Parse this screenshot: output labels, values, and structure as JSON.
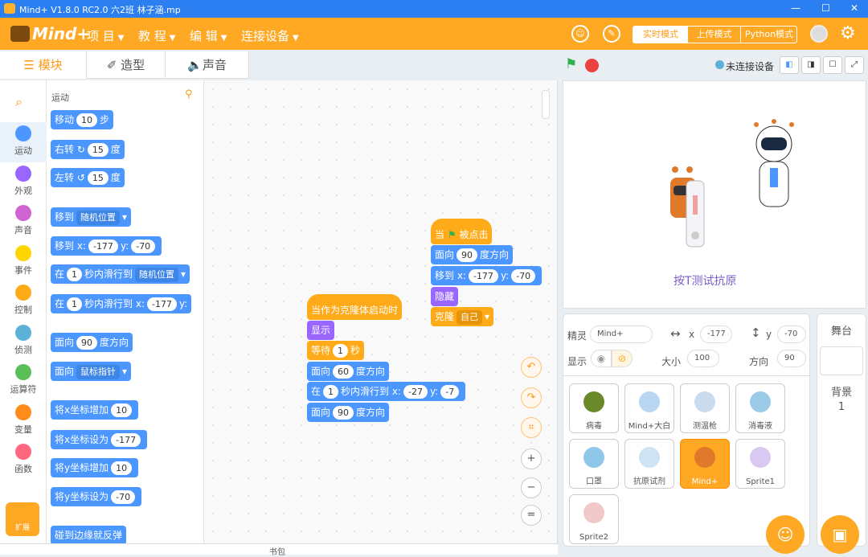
{
  "window": {
    "title": "Mind+ V1.8.0 RC2.0   六2班 林子涵.mp",
    "min": "—",
    "max": "☐",
    "close": "✕"
  },
  "menu": {
    "brand": "Mind+",
    "project": "项 目",
    "tutorial": "教 程",
    "edit": "编 辑",
    "connect": "连接设备"
  },
  "modes": {
    "realtime": "实时模式",
    "upload": "上传模式",
    "python": "Python模式"
  },
  "tabs": {
    "blocks": "模块",
    "costumes": "造型",
    "sounds": "声音"
  },
  "categories": [
    {
      "label": "运动",
      "color": "#4c97ff"
    },
    {
      "label": "外观",
      "color": "#9966ff"
    },
    {
      "label": "声音",
      "color": "#cf63cf"
    },
    {
      "label": "事件",
      "color": "#ffd500"
    },
    {
      "label": "控制",
      "color": "#ffab19"
    },
    {
      "label": "侦测",
      "color": "#5cb1d6"
    },
    {
      "label": "运算符",
      "color": "#59c059"
    },
    {
      "label": "变量",
      "color": "#ff8c1a"
    },
    {
      "label": "函数",
      "color": "#ff6680"
    }
  ],
  "extension": {
    "label": "扩展"
  },
  "palette": {
    "heading": "运动",
    "move": {
      "a": "移动",
      "v": "10",
      "b": "步"
    },
    "turn_right": {
      "a": "右转",
      "v": "15",
      "b": "度"
    },
    "turn_left": {
      "a": "左转",
      "v": "15",
      "b": "度"
    },
    "goto": {
      "a": "移到",
      "d": "随机位置"
    },
    "goto_xy": {
      "a": "移到 x:",
      "x": "-177",
      "b": "y:",
      "y": "-70"
    },
    "glide": {
      "a": "在",
      "v": "1",
      "b": "秒内滑行到",
      "d": "随机位置"
    },
    "glide_xy": {
      "a": "在",
      "v": "1",
      "b": "秒内滑行到 x:",
      "x": "-177",
      "c": "y:"
    },
    "point_dir": {
      "a": "面向",
      "v": "90",
      "b": "度方向"
    },
    "point_to": {
      "a": "面向",
      "d": "鼠标指针"
    },
    "change_x": {
      "a": "将x坐标增加",
      "v": "10"
    },
    "set_x": {
      "a": "将x坐标设为",
      "v": "-177"
    },
    "change_y": {
      "a": "将y坐标增加",
      "v": "10"
    },
    "set_y": {
      "a": "将y坐标设为",
      "v": "-70"
    },
    "bounce": {
      "a": "碰到边缘就反弹"
    }
  },
  "script1": {
    "hat": {
      "a": "当",
      "b": "被点击"
    },
    "b1": {
      "a": "面向",
      "v": "90",
      "b": "度方向"
    },
    "b2": {
      "a": "移到 x:",
      "x": "-177",
      "b": "y:",
      "y": "-70"
    },
    "b3": {
      "a": "隐藏"
    },
    "b4": {
      "a": "克隆",
      "d": "自己"
    }
  },
  "script2": {
    "hat": {
      "a": "当作为克隆体启动时"
    },
    "b1": {
      "a": "显示"
    },
    "b2": {
      "a": "等待",
      "v": "1",
      "b": "秒"
    },
    "b3": {
      "a": "面向",
      "v": "60",
      "b": "度方向"
    },
    "b4": {
      "a": "在",
      "v": "1",
      "b": "秒内滑行到 x:",
      "x": "-27",
      "c": "y:",
      "y": "-7"
    },
    "b5": {
      "a": "面向",
      "v": "90",
      "b": "度方向"
    }
  },
  "stage": {
    "status": "未连接设备",
    "caption": "按T测试抗原"
  },
  "sprite": {
    "label": "精灵",
    "name": "Mind+",
    "x_label": "x",
    "x": "-177",
    "y_label": "y",
    "y": "-70",
    "show": "显示",
    "size_label": "大小",
    "size": "100",
    "dir_label": "方向",
    "dir": "90"
  },
  "sprites": [
    {
      "name": "病毒",
      "color": "#6a8a2a"
    },
    {
      "name": "Mind+大白",
      "color": "#b8d6f2"
    },
    {
      "name": "测温枪",
      "color": "#c8dcee"
    },
    {
      "name": "消毒液",
      "color": "#9bc9e8"
    },
    {
      "name": "口罩",
      "color": "#8fc7e8"
    },
    {
      "name": "抗原试剂",
      "color": "#cfe3f2"
    },
    {
      "name": "Mind+",
      "color": "#e07a2a"
    },
    {
      "name": "Sprite1",
      "color": "#d8c8f2"
    },
    {
      "name": "Sprite2",
      "color": "#f2c8c8"
    }
  ],
  "stagepanel": {
    "title": "舞台",
    "bg_label": "背景",
    "bg_count": "1"
  },
  "bottom": {
    "backpack": "书包"
  }
}
